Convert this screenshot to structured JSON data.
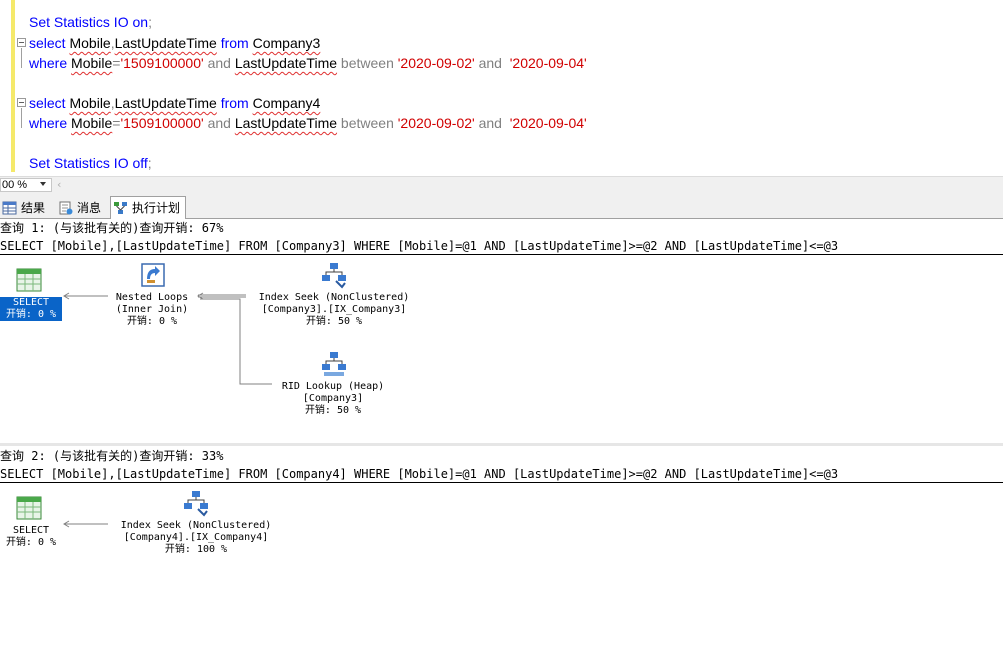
{
  "editor": {
    "lines": {
      "l1": {
        "kw1": "Set Statistics IO on",
        "punct": ";"
      },
      "l2": {
        "kw1": "select",
        "col1": "Mobile",
        "comma": ",",
        "col2": "LastUpdateTime",
        "kw2": "from",
        "tbl": "Company3"
      },
      "l3": {
        "kw1": "where",
        "col1": "Mobile",
        "op": "=",
        "str1": "'1509100000'",
        "and1": "and",
        "col2": "LastUpdateTime",
        "between": "between",
        "str2": "'2020-09-02'",
        "and2": "and",
        "str3": "'2020-09-04'"
      },
      "l5": {
        "kw1": "select",
        "col1": "Mobile",
        "comma": ",",
        "col2": "LastUpdateTime",
        "kw2": "from",
        "tbl": "Company4"
      },
      "l6": {
        "kw1": "where",
        "col1": "Mobile",
        "op": "=",
        "str1": "'1509100000'",
        "and1": "and",
        "col2": "LastUpdateTime",
        "between": "between",
        "str2": "'2020-09-02'",
        "and2": "and",
        "str3": "'2020-09-04'"
      },
      "l8": {
        "kw1": "Set Statistics IO off",
        "punct": ";"
      }
    }
  },
  "zoom": {
    "value": "00 %"
  },
  "tabs": {
    "results": "结果",
    "messages": "消息",
    "plan": "执行计划"
  },
  "queries": {
    "q1": {
      "header": "查询 1: (与该批有关的)查询开销: 67%",
      "sql": "SELECT [Mobile],[LastUpdateTime] FROM [Company3] WHERE [Mobile]=@1 AND [LastUpdateTime]>=@2 AND [LastUpdateTime]<=@3",
      "select": {
        "name": "SELECT",
        "cost": "开销: 0 %"
      },
      "nested": {
        "name": "Nested Loops",
        "sub": "(Inner Join)",
        "cost": "开销: 0 %"
      },
      "seek": {
        "name": "Index Seek (NonClustered)",
        "sub": "[Company3].[IX_Company3]",
        "cost": "开销: 50 %"
      },
      "rid": {
        "name": "RID Lookup (Heap)",
        "sub": "[Company3]",
        "cost": "开销: 50 %"
      }
    },
    "q2": {
      "header": "查询 2: (与该批有关的)查询开销: 33%",
      "sql": "SELECT [Mobile],[LastUpdateTime] FROM [Company4] WHERE [Mobile]=@1 AND [LastUpdateTime]>=@2 AND [LastUpdateTime]<=@3",
      "select": {
        "name": "SELECT",
        "cost": "开销: 0 %"
      },
      "seek": {
        "name": "Index Seek (NonClustered)",
        "sub": "[Company4].[IX_Company4]",
        "cost": "开销: 100 %"
      }
    }
  }
}
